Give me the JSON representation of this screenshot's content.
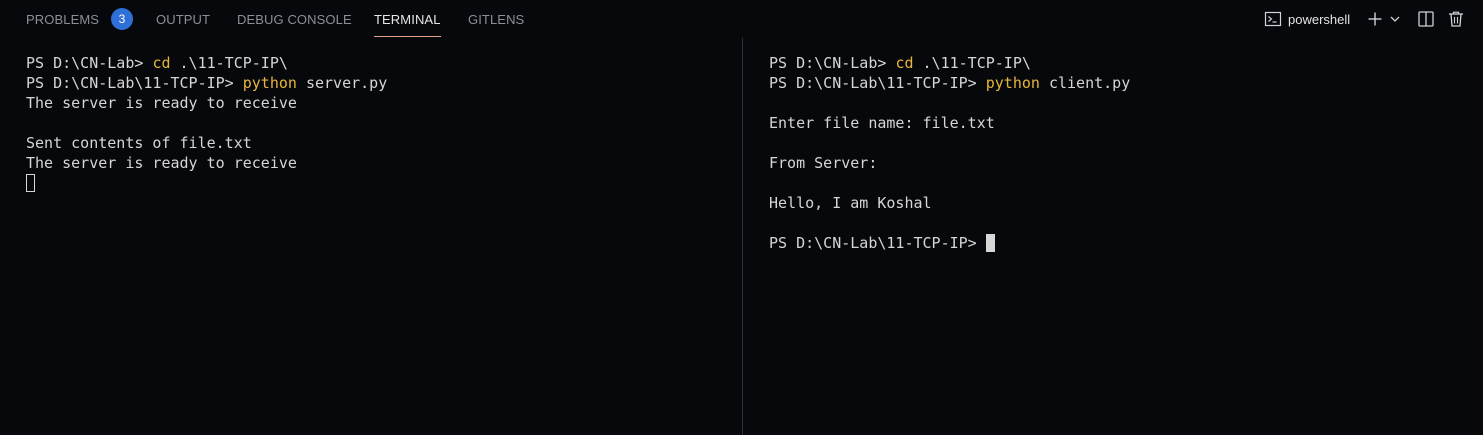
{
  "tabs": [
    {
      "label": "PROBLEMS",
      "badge": "3",
      "active": false
    },
    {
      "label": "OUTPUT",
      "active": false
    },
    {
      "label": "DEBUG CONSOLE",
      "active": false
    },
    {
      "label": "TERMINAL",
      "active": true
    },
    {
      "label": "GITLENS",
      "active": false
    }
  ],
  "terminal_profile": "powershell",
  "icons": {
    "profile": "terminal-icon",
    "new_terminal": "plus-icon",
    "launch_profile": "chevron-down-icon",
    "split": "split-terminal-icon",
    "kill": "trash-icon"
  },
  "colors": {
    "background": "#07080c",
    "text": "#d6d6d6",
    "command": "#e8b53b",
    "active_tab_underline": "#e7a08a",
    "badge": "#2f6fd8"
  },
  "left_pane": {
    "lines": [
      {
        "prompt": "PS D:\\CN-Lab> ",
        "cmd": "cd",
        "rest": " .\\11-TCP-IP\\"
      },
      {
        "prompt": "PS D:\\CN-Lab\\11-TCP-IP> ",
        "cmd": "python",
        "rest": " server.py"
      },
      {
        "text": "The server is ready to receive"
      },
      {
        "text": ""
      },
      {
        "text": "Sent contents of file.txt"
      },
      {
        "text": "The server is ready to receive"
      }
    ]
  },
  "right_pane": {
    "lines": [
      {
        "prompt": "PS D:\\CN-Lab> ",
        "cmd": "cd",
        "rest": " .\\11-TCP-IP\\"
      },
      {
        "prompt": "PS D:\\CN-Lab\\11-TCP-IP> ",
        "cmd": "python",
        "rest": " client.py"
      },
      {
        "text": ""
      },
      {
        "text": "Enter file name: file.txt"
      },
      {
        "text": ""
      },
      {
        "text": "From Server:"
      },
      {
        "text": ""
      },
      {
        "text": "Hello, I am Koshal"
      },
      {
        "text": ""
      },
      {
        "prompt": "PS D:\\CN-Lab\\11-TCP-IP> "
      }
    ]
  }
}
